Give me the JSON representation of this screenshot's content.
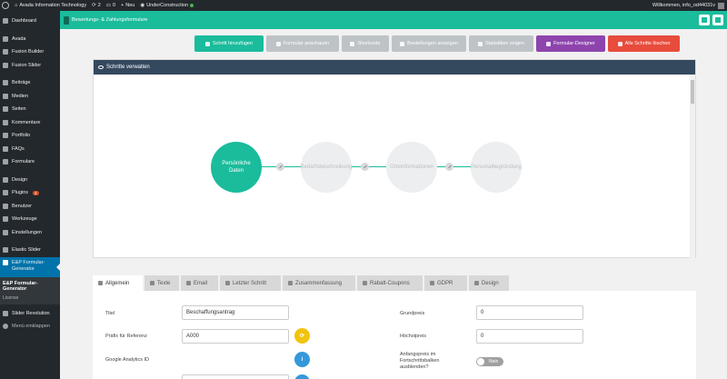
{
  "adminbar": {
    "site_name": "Avada Information Technology",
    "updates_count": "2",
    "comments_count": "0",
    "new_label": "Neu",
    "plugin_label": "UnderConstruction",
    "welcome": "Willkommen, info_od44031v"
  },
  "sidebar": {
    "items": [
      {
        "label": "Dashboard",
        "icon": "dashboard-icon"
      },
      {
        "label": "Avada",
        "icon": "avada-icon"
      },
      {
        "label": "Fusion Builder",
        "icon": "fusion-builder-icon"
      },
      {
        "label": "Fusion Slider",
        "icon": "fusion-slider-icon"
      },
      {
        "label": "Beiträge",
        "icon": "pin-icon"
      },
      {
        "label": "Medien",
        "icon": "media-icon"
      },
      {
        "label": "Seiten",
        "icon": "pages-icon"
      },
      {
        "label": "Kommentare",
        "icon": "comments-icon"
      },
      {
        "label": "Portfolio",
        "icon": "portfolio-icon"
      },
      {
        "label": "FAQs",
        "icon": "faq-icon"
      },
      {
        "label": "Formulare",
        "icon": "forms-icon"
      },
      {
        "label": "Design",
        "icon": "design-icon"
      },
      {
        "label": "Plugins",
        "icon": "plugins-icon",
        "badge": "2"
      },
      {
        "label": "Benutzer",
        "icon": "users-icon"
      },
      {
        "label": "Werkzeuge",
        "icon": "tools-icon"
      },
      {
        "label": "Einstellungen",
        "icon": "settings-icon"
      },
      {
        "label": "Elastic Slider",
        "icon": "elastic-slider-icon"
      }
    ],
    "active": {
      "label": "E&P Formular-Generator",
      "icon": "form-generator-icon"
    },
    "submenu": {
      "current": "E&P Formular-Generator",
      "license": "License"
    },
    "after": [
      {
        "label": "Slider Revolution",
        "icon": "slider-revolution-icon"
      },
      {
        "label": "Menü einklappen",
        "icon": "collapse-icon"
      }
    ]
  },
  "header": {
    "title": "Bewertungs- & Zahlungsformulare"
  },
  "actions": {
    "add_step": "Schritt hinzufügen",
    "view_form": "Formular anschauen",
    "shortcode": "Shortcode",
    "orders": "Bestellungen anzeigen",
    "stats": "Statistiken zeigen",
    "designer": "Formular-Designer",
    "delete_all": "Alle Schritte löschen"
  },
  "panel": {
    "title": "Schritte verwalten",
    "steps": [
      "Persönliche Daten",
      "Bedarfsbeschreibung",
      "Orteinformationen",
      "Personalbegründung"
    ]
  },
  "tabs": [
    {
      "label": "Allgemein",
      "icon": "gear-icon"
    },
    {
      "label": "Texte",
      "icon": "text-icon"
    },
    {
      "label": "Email",
      "icon": "email-icon"
    },
    {
      "label": "Letzter Schritt",
      "icon": "list-icon"
    },
    {
      "label": "Zusammenfassung",
      "icon": "cart-icon"
    },
    {
      "label": "Rabatt-Coupons",
      "icon": "coupon-icon"
    },
    {
      "label": "GDPR",
      "icon": "gdpr-icon"
    },
    {
      "label": "Design",
      "icon": "drop-icon"
    }
  ],
  "form": {
    "title_label": "Titel",
    "title_value": "Beschaffungsantrag",
    "prefix_label": "Präfix für Referenz",
    "prefix_value": "A000",
    "ga_label": "Google Analytics ID",
    "base_price_label": "Grundpreis",
    "base_price_value": "0",
    "max_price_label": "Höchstpreis",
    "max_price_value": "0",
    "hide_initial_label": "Anfangspreis im Fortschrittsbalken ausblenden?",
    "toggle_label": "Nein",
    "info_symbol": "i"
  },
  "colors": {
    "accent": "#1abc9c",
    "purple": "#8e44ad",
    "red": "#e74c3c",
    "header_dark": "#34495e"
  }
}
